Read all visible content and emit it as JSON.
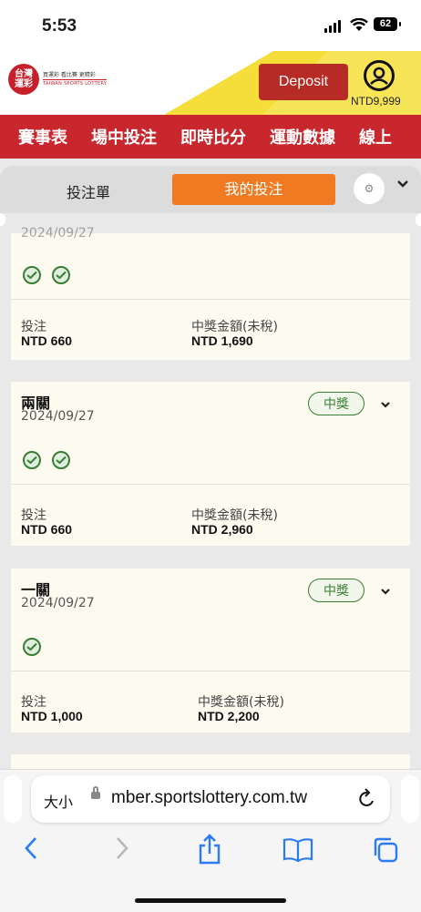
{
  "status": {
    "time": "5:53",
    "battery": "62"
  },
  "header": {
    "logo": {
      "seal": "台灣\n運彩",
      "line1": "買運彩 看比賽 更精彩",
      "line2": "TAIWAN SPORTS LOTTERY"
    },
    "deposit_label": "Deposit",
    "balance": "NTD9,999"
  },
  "nav": {
    "items": [
      "賽事表",
      "場中投注",
      "即時比分",
      "運動數據",
      "線上"
    ]
  },
  "tabs": {
    "tab1": "投注單",
    "tab2": "我的投注"
  },
  "bets": [
    {
      "date": "2024/09/27",
      "checks": 2,
      "stake_label": "投注",
      "stake": "NTD 660",
      "payout_label": "中獎金額(未稅)",
      "payout": "NTD 1,690"
    },
    {
      "title": "兩關",
      "date": "2024/09/27",
      "badge": "中獎",
      "checks": 2,
      "stake_label": "投注",
      "stake": "NTD 660",
      "payout_label": "中獎金額(未稅)",
      "payout": "NTD 2,960"
    },
    {
      "title": "一關",
      "date": "2024/09/27",
      "badge": "中獎",
      "checks": 1,
      "stake_label": "投注",
      "stake": "NTD 1,000",
      "payout_label": "中獎金額(未稅)",
      "payout": "NTD 2,200"
    }
  ],
  "safari": {
    "text_size_label": "大小",
    "url": "mber.sportslottery.com.tw"
  },
  "colors": {
    "brand_red": "#c8272d",
    "accent_orange": "#f07a22",
    "win_green": "#3a7d34",
    "header_yellow": "#f5dd3a"
  }
}
